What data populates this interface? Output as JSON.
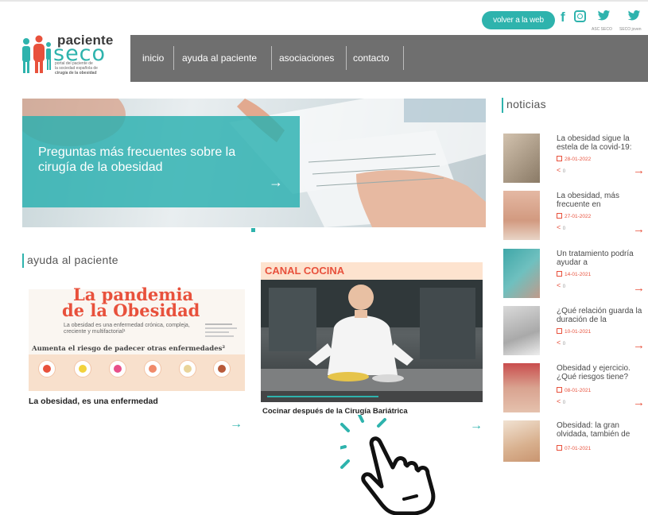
{
  "header": {
    "back_button": "volver a la web",
    "social": [
      {
        "icon": "facebook-icon",
        "glyph": "f",
        "label": ""
      },
      {
        "icon": "instagram-icon",
        "glyph": "◎",
        "label": ""
      },
      {
        "icon": "twitter-icon",
        "glyph": "🐦",
        "label": "ASC SECO"
      },
      {
        "icon": "twitter-icon",
        "glyph": "🐦",
        "label": "SECO joven"
      }
    ]
  },
  "logo": {
    "word1": "paciente",
    "word2": "seco",
    "sub": [
      "portal del paciente de",
      "la sociedad española de",
      "cirugía de la obesidad"
    ]
  },
  "nav": {
    "items": [
      "inicio",
      "ayuda al paciente",
      "asociaciones",
      "contacto"
    ]
  },
  "hero": {
    "title": "Preguntas más frecuentes sobre la cirugía de la obesidad",
    "arrow": "→"
  },
  "ayuda": {
    "title": "ayuda al paciente"
  },
  "cards": [
    {
      "headline1": "La pandemia",
      "headline2": "de la Obesidad",
      "desc": "La obesidad es una enfermedad crónica, compleja, creciente y multifactorial¹",
      "risk": "Aumenta el riesgo de padecer otras enfermedades²",
      "caption": "La obesidad, es una enfermedad",
      "arrow": "→"
    },
    {
      "top_label": "CANAL COCINA",
      "caption": "Cocinar después de la Cirugía Bariátrica",
      "arrow": "→"
    }
  ],
  "news": {
    "title": "noticias",
    "items": [
      {
        "title": "La obesidad sigue la estela de la covid-19:",
        "date": "28-01-2022",
        "count": "0"
      },
      {
        "title": "La obesidad, más frecuente en",
        "date": "27-01-2022",
        "count": "0"
      },
      {
        "title": "Un tratamiento podría ayudar a",
        "date": "14-01-2021",
        "count": "0"
      },
      {
        "title": "¿Qué relación guarda la duración de la",
        "date": "10-01-2021",
        "count": "0"
      },
      {
        "title": "Obesidad y ejercicio. ¿Qué riesgos tiene?",
        "date": "08-01-2021",
        "count": "0"
      },
      {
        "title": "Obesidad: la gran olvidada, también de",
        "date": "07-01-2021",
        "count": ""
      }
    ],
    "share_glyph": "<",
    "arrow": "→"
  },
  "colors": {
    "accent": "#2eb3ad",
    "nav": "#6f6f6f",
    "orange": "#e8513c"
  }
}
